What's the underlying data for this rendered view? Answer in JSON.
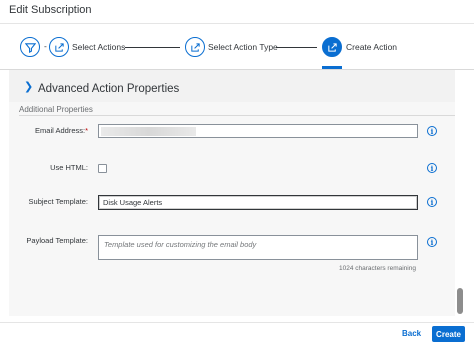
{
  "dialog": {
    "title": "Edit Subscription"
  },
  "wizard": {
    "separator": "-",
    "steps": [
      {
        "label": "",
        "icon": "filter-icon",
        "state": "completed"
      },
      {
        "label": "Select Actions",
        "icon": "share-icon",
        "state": "completed"
      },
      {
        "label": "Select Action Type",
        "icon": "share-icon",
        "state": "completed"
      },
      {
        "label": "Create Action",
        "icon": "share-icon",
        "state": "active"
      }
    ]
  },
  "panel": {
    "title": "Advanced Action Properties",
    "expand_icon": "chevron-right-icon"
  },
  "section": {
    "title": "Additional Properties"
  },
  "fields": {
    "email": {
      "label": "Email Address:",
      "required_mark": "*",
      "value": ""
    },
    "use_html": {
      "label": "Use HTML:",
      "checked": false
    },
    "subject": {
      "label": "Subject Template:",
      "value": "Disk Usage Alerts"
    },
    "payload": {
      "label": "Payload Template:",
      "placeholder": "Template used for customizing the email body",
      "counter": "1024 characters remaining"
    }
  },
  "info_icon": "i",
  "footer": {
    "back_label": "Back",
    "create_label": "Create"
  },
  "colors": {
    "accent": "#0a6ed1",
    "required": "#bb0000",
    "text": "#32363a"
  }
}
